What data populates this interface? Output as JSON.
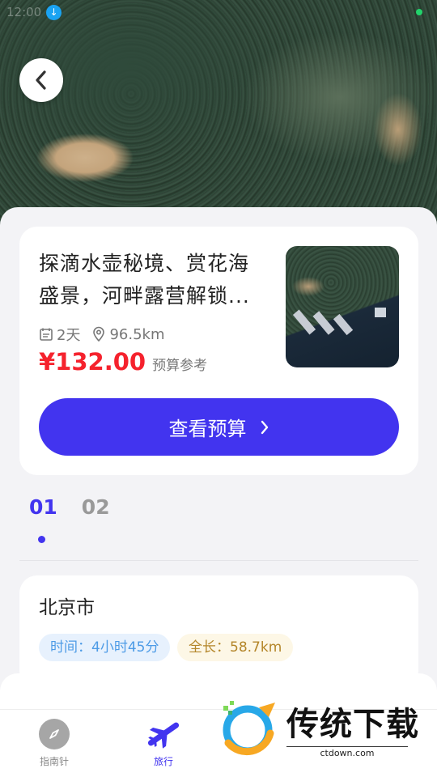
{
  "status_bar": {
    "time": "12:00"
  },
  "header": {
    "back_icon": "chevron-left-icon"
  },
  "route_card": {
    "title_line1": "探滴水壶秘境、赏花海",
    "title_line2": "盛景，河畔露营解锁...",
    "days": "2天",
    "distance": "96.5km",
    "price": "¥132.00",
    "price_note": "预算参考",
    "budget_button": "查看预算"
  },
  "day_tabs": [
    {
      "label": "01",
      "active": true
    },
    {
      "label": "02",
      "active": false
    }
  ],
  "day_detail": {
    "city": "北京市",
    "time_pill": "时间：4小时45分",
    "length_pill": "全长：58.7km"
  },
  "bottom_nav": [
    {
      "label": "指南针",
      "icon": "compass-icon"
    },
    {
      "label": "旅行",
      "icon": "plane-icon"
    }
  ],
  "watermark": {
    "text": "传统下载",
    "url": "ctdown.com"
  },
  "colors": {
    "accent": "#4234ef",
    "price": "#f5222d"
  }
}
